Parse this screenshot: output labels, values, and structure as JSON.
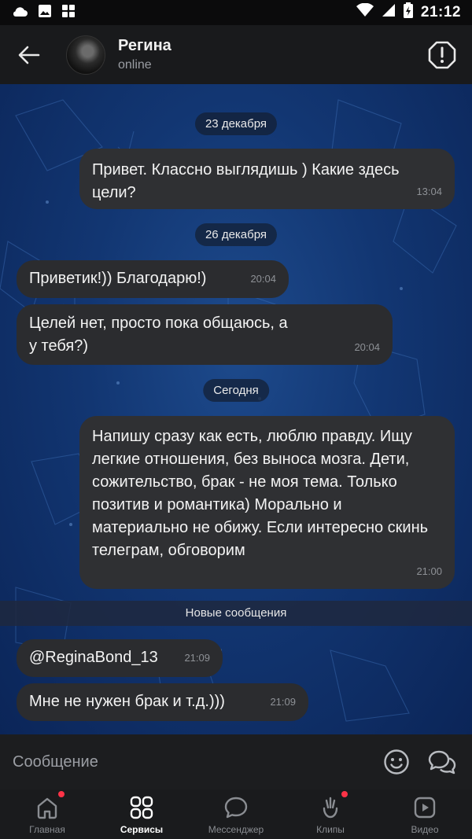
{
  "status_bar": {
    "time": "21:12"
  },
  "header": {
    "name": "Регина",
    "status": "online"
  },
  "messages": [
    {
      "type": "date",
      "text": "23 декабря"
    },
    {
      "type": "out",
      "text": "Привет. Классно выглядишь ) Какие здесь цели?",
      "time": "13:04"
    },
    {
      "type": "date",
      "text": "26 декабря"
    },
    {
      "type": "in",
      "text": "Приветик!)) Благодарю!)",
      "time": "20:04"
    },
    {
      "type": "in",
      "text": "Целей нет, просто пока общаюсь, а у тебя?)",
      "time": "20:04"
    },
    {
      "type": "date",
      "text": "Сегодня"
    },
    {
      "type": "out",
      "text": "Напишу сразу как есть, люблю правду. Ищу легкие отношения, без выноса мозга. Дети, сожительство, брак - не моя тема. Только позитив и романтика) Морально и материально не обижу. Если интересно скинь телеграм, обговорим",
      "time": "21:00"
    },
    {
      "type": "divider",
      "text": "Новые сообщения"
    },
    {
      "type": "in",
      "text": "@ReginaBond_13",
      "time": "21:09"
    },
    {
      "type": "in",
      "text": "Мне не нужен брак и т.д.)))",
      "time": "21:09"
    }
  ],
  "composer": {
    "placeholder": "Сообщение"
  },
  "tabs": [
    {
      "label": "Главная",
      "icon": "home-icon",
      "active": false,
      "badge": true
    },
    {
      "label": "Сервисы",
      "icon": "services-icon",
      "active": true,
      "badge": false
    },
    {
      "label": "Мессенджер",
      "icon": "messenger-icon",
      "active": false,
      "badge": false
    },
    {
      "label": "Клипы",
      "icon": "clips-icon",
      "active": false,
      "badge": true
    },
    {
      "label": "Видео",
      "icon": "video-icon",
      "active": false,
      "badge": false
    }
  ],
  "colors": {
    "accent_badge": "#ff3347",
    "bubble": "#2f3033",
    "header": "#191a1c"
  }
}
